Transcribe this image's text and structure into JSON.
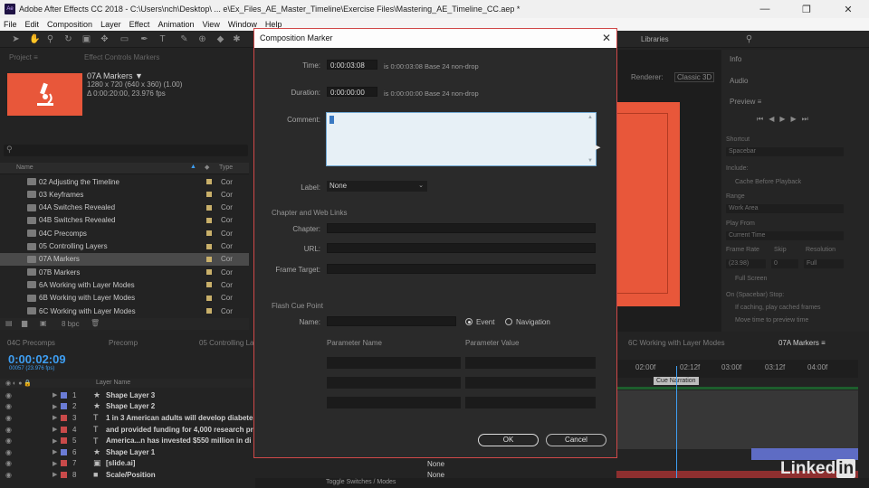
{
  "window": {
    "title": "Adobe After Effects CC 2018 - C:\\Users\\nch\\Desktop\\ ... e\\Ex_Files_AE_Master_Timeline\\Exercise Files\\Mastering_AE_Timeline_CC.aep *",
    "app_icon": "Ae",
    "min": "—",
    "max": "❐",
    "close": "✕"
  },
  "menu": [
    "File",
    "Edit",
    "Composition",
    "Layer",
    "Effect",
    "Animation",
    "View",
    "Window",
    "Help"
  ],
  "toolbar": {
    "libraries_label": "Libraries"
  },
  "project": {
    "tab_project": "Project ≡",
    "tab_effects": "Effect Controls Markers",
    "comp_name": "07A Markers ▼",
    "comp_size": "1280 x 720 (640 x 360) (1.00)",
    "comp_duration": "Δ 0:00:20:00, 23.976 fps",
    "search_icon": "⚲",
    "col_name": "Name",
    "col_type": "Type",
    "items": [
      {
        "name": "02 Adjusting the Timeline",
        "type": "Cor"
      },
      {
        "name": "03 Keyframes",
        "type": "Cor"
      },
      {
        "name": "04A Switches Revealed",
        "type": "Cor"
      },
      {
        "name": "04B Switches Revealed",
        "type": "Cor"
      },
      {
        "name": "04C Precomps",
        "type": "Cor"
      },
      {
        "name": "05 Controlling Layers",
        "type": "Cor"
      },
      {
        "name": "07A Markers",
        "type": "Cor",
        "selected": true
      },
      {
        "name": "07B Markers",
        "type": "Cor"
      },
      {
        "name": "6A Working with Layer Modes",
        "type": "Cor"
      },
      {
        "name": "6B Working with Layer Modes",
        "type": "Cor"
      },
      {
        "name": "6C Working with Layer Modes",
        "type": "Cor"
      }
    ],
    "bpc": "8 bpc"
  },
  "right_panel": {
    "info": "Info",
    "audio": "Audio",
    "preview": "Preview ≡",
    "shortcut": "Shortcut",
    "shortcut_val": "Spacebar",
    "include": "Include:",
    "cache": "Cache Before Playback",
    "range": "Range",
    "range_val": "Work Area",
    "play_from": "Play From",
    "play_from_val": "Current Time",
    "frame_rate": "Frame Rate",
    "skip": "Skip",
    "resolution": "Resolution",
    "fr_val": "(23.98)",
    "skip_val": "0",
    "res_val": "Full",
    "full_screen": "Full Screen",
    "on_stop": "On (Spacebar) Stop:",
    "if_caching": "If caching, play cached frames",
    "move_time": "Move time to preview time",
    "renderer": "Renderer:",
    "renderer_val": "Classic 3D"
  },
  "timeline": {
    "tabs": [
      "04C Precomps",
      "Precomp",
      "05 Controlling La...",
      "6C Working with Layer Modes",
      "07A Markers ≡"
    ],
    "timecode": "0:00:02:09",
    "timecode_sub": "00057 (23.976 fps)",
    "col_layer_name": "Layer Name",
    "ruler": [
      "02:00f",
      "02:12f",
      "03:00f",
      "03:12f",
      "04:00f"
    ],
    "marker_label": "Cue Narration",
    "layers": [
      {
        "num": "1",
        "icon": "★",
        "name": "Shape Layer 3",
        "color": "#6b7cd6"
      },
      {
        "num": "2",
        "icon": "★",
        "name": "Shape Layer 2",
        "color": "#6b7cd6"
      },
      {
        "num": "3",
        "icon": "T",
        "name": "1 in 3 American adults  will develop diabete",
        "color": "#c94a4a"
      },
      {
        "num": "4",
        "icon": "T",
        "name": "and provided funding for  4,000 research pr",
        "color": "#c94a4a"
      },
      {
        "num": "5",
        "icon": "T",
        "name": "America...n has invested $550 million  in di",
        "color": "#c94a4a"
      },
      {
        "num": "6",
        "icon": "★",
        "name": "Shape Layer 1",
        "color": "#6b7cd6"
      },
      {
        "num": "7",
        "icon": "▣",
        "name": "[slide.ai]",
        "color": "#c94a4a"
      },
      {
        "num": "8",
        "icon": "■",
        "name": "Scale/Position",
        "color": "#c94a4a"
      }
    ],
    "mode_none_1": "None",
    "mode_none_2": "None",
    "toggle_label": "Toggle Switches / Modes"
  },
  "dialog": {
    "title": "Composition Marker",
    "close": "✕",
    "time_label": "Time:",
    "time_val": "0:00:03:08",
    "time_note": "is 0:00:03:08  Base 24  non-drop",
    "duration_label": "Duration:",
    "duration_val": "0:00:00:00",
    "duration_note": "is 0:00:00:00  Base 24  non-drop",
    "comment_label": "Comment:",
    "label_label": "Label:",
    "label_val": "None",
    "chapter_section": "Chapter and Web Links",
    "chapter_label": "Chapter:",
    "url_label": "URL:",
    "frame_target_label": "Frame Target:",
    "flash_section": "Flash Cue Point",
    "name_label": "Name:",
    "event_label": "Event",
    "navigation_label": "Navigation",
    "param_name": "Parameter Name",
    "param_value": "Parameter Value",
    "ok": "OK",
    "cancel": "Cancel"
  },
  "watermark": {
    "text": "Linked",
    "badge": "in"
  }
}
